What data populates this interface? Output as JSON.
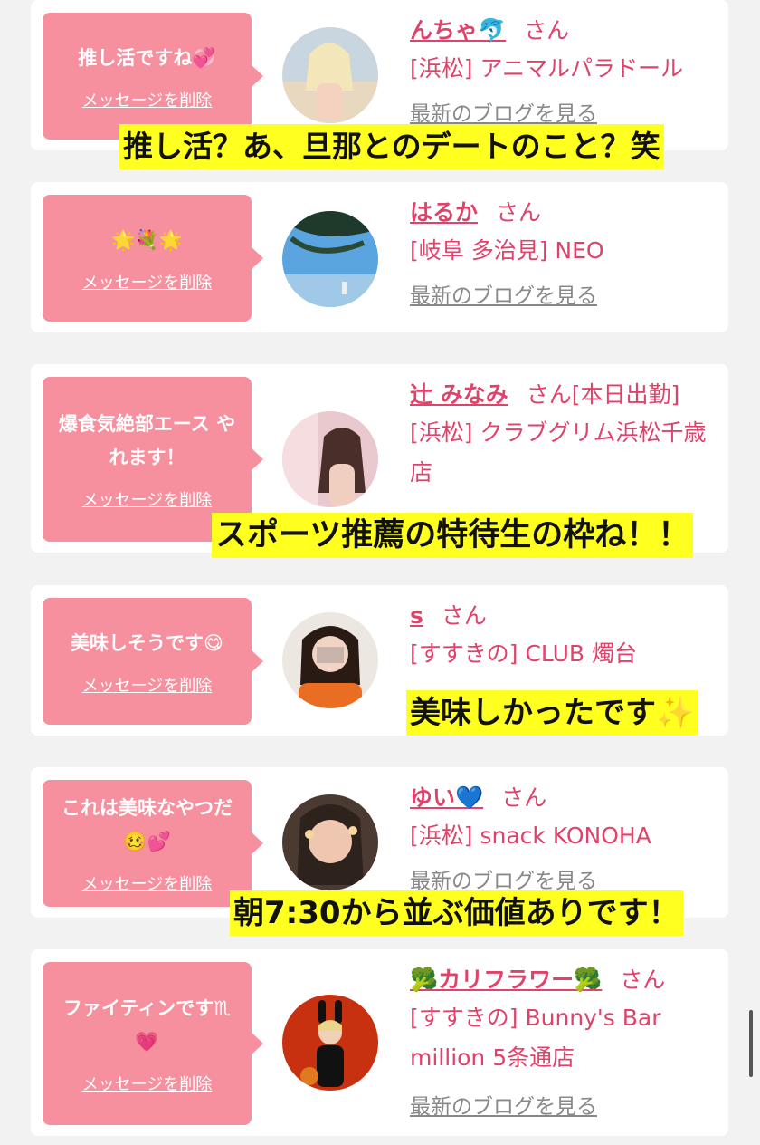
{
  "colors": {
    "bubble": "#f6909e",
    "accent": "#e0426a",
    "caption_bg": "#ffff20",
    "page_bg": "#f2f2f2"
  },
  "delete_label": "メッセージを削除",
  "blog_label": "最新のブログを見る",
  "san_label": "さん",
  "cards": [
    {
      "message": "推し活ですね💞",
      "name": "んちゃ🐬",
      "shop": "[浜松] アニマルパラドール",
      "blog_visible": true
    },
    {
      "message": "🌟💐🌟",
      "name": "はるか",
      "shop": "[岐阜 多治見] NEO",
      "blog_visible": true
    },
    {
      "message": "爆食気絶部エース やれます！",
      "name": "辻 みなみ",
      "name_suffix": "[本日出勤]",
      "shop": "[浜松] クラブグリム浜松千歳店",
      "blog_visible": false
    },
    {
      "message": "美味しそうです😋",
      "name": "s",
      "shop": "[すすきの] CLUB 燭台",
      "blog_visible": false
    },
    {
      "message": "これは美味なやつだ🥴💕",
      "name": "ゆい💙",
      "shop": "[浜松] snack KONOHA",
      "blog_visible": true
    },
    {
      "message": "ファイティンです♏💗",
      "name": "🥦カリフラワー🥦",
      "shop": "[すすきの] Bunny's Bar million 5条通店",
      "blog_visible": true
    }
  ],
  "captions": [
    "推し活？あ、旦那とのデートのこと？笑",
    "スポーツ推薦の特待生の枠ね！！",
    "美味しかったです✨",
    "朝7:30から並ぶ価値ありです！"
  ],
  "avatar_images": [
    "woman-beach-photo",
    "sky-tree-photo",
    "woman-summer-photo",
    "woman-blurred-face-photo",
    "woman-filter-photo",
    "bunny-costume-photo"
  ]
}
